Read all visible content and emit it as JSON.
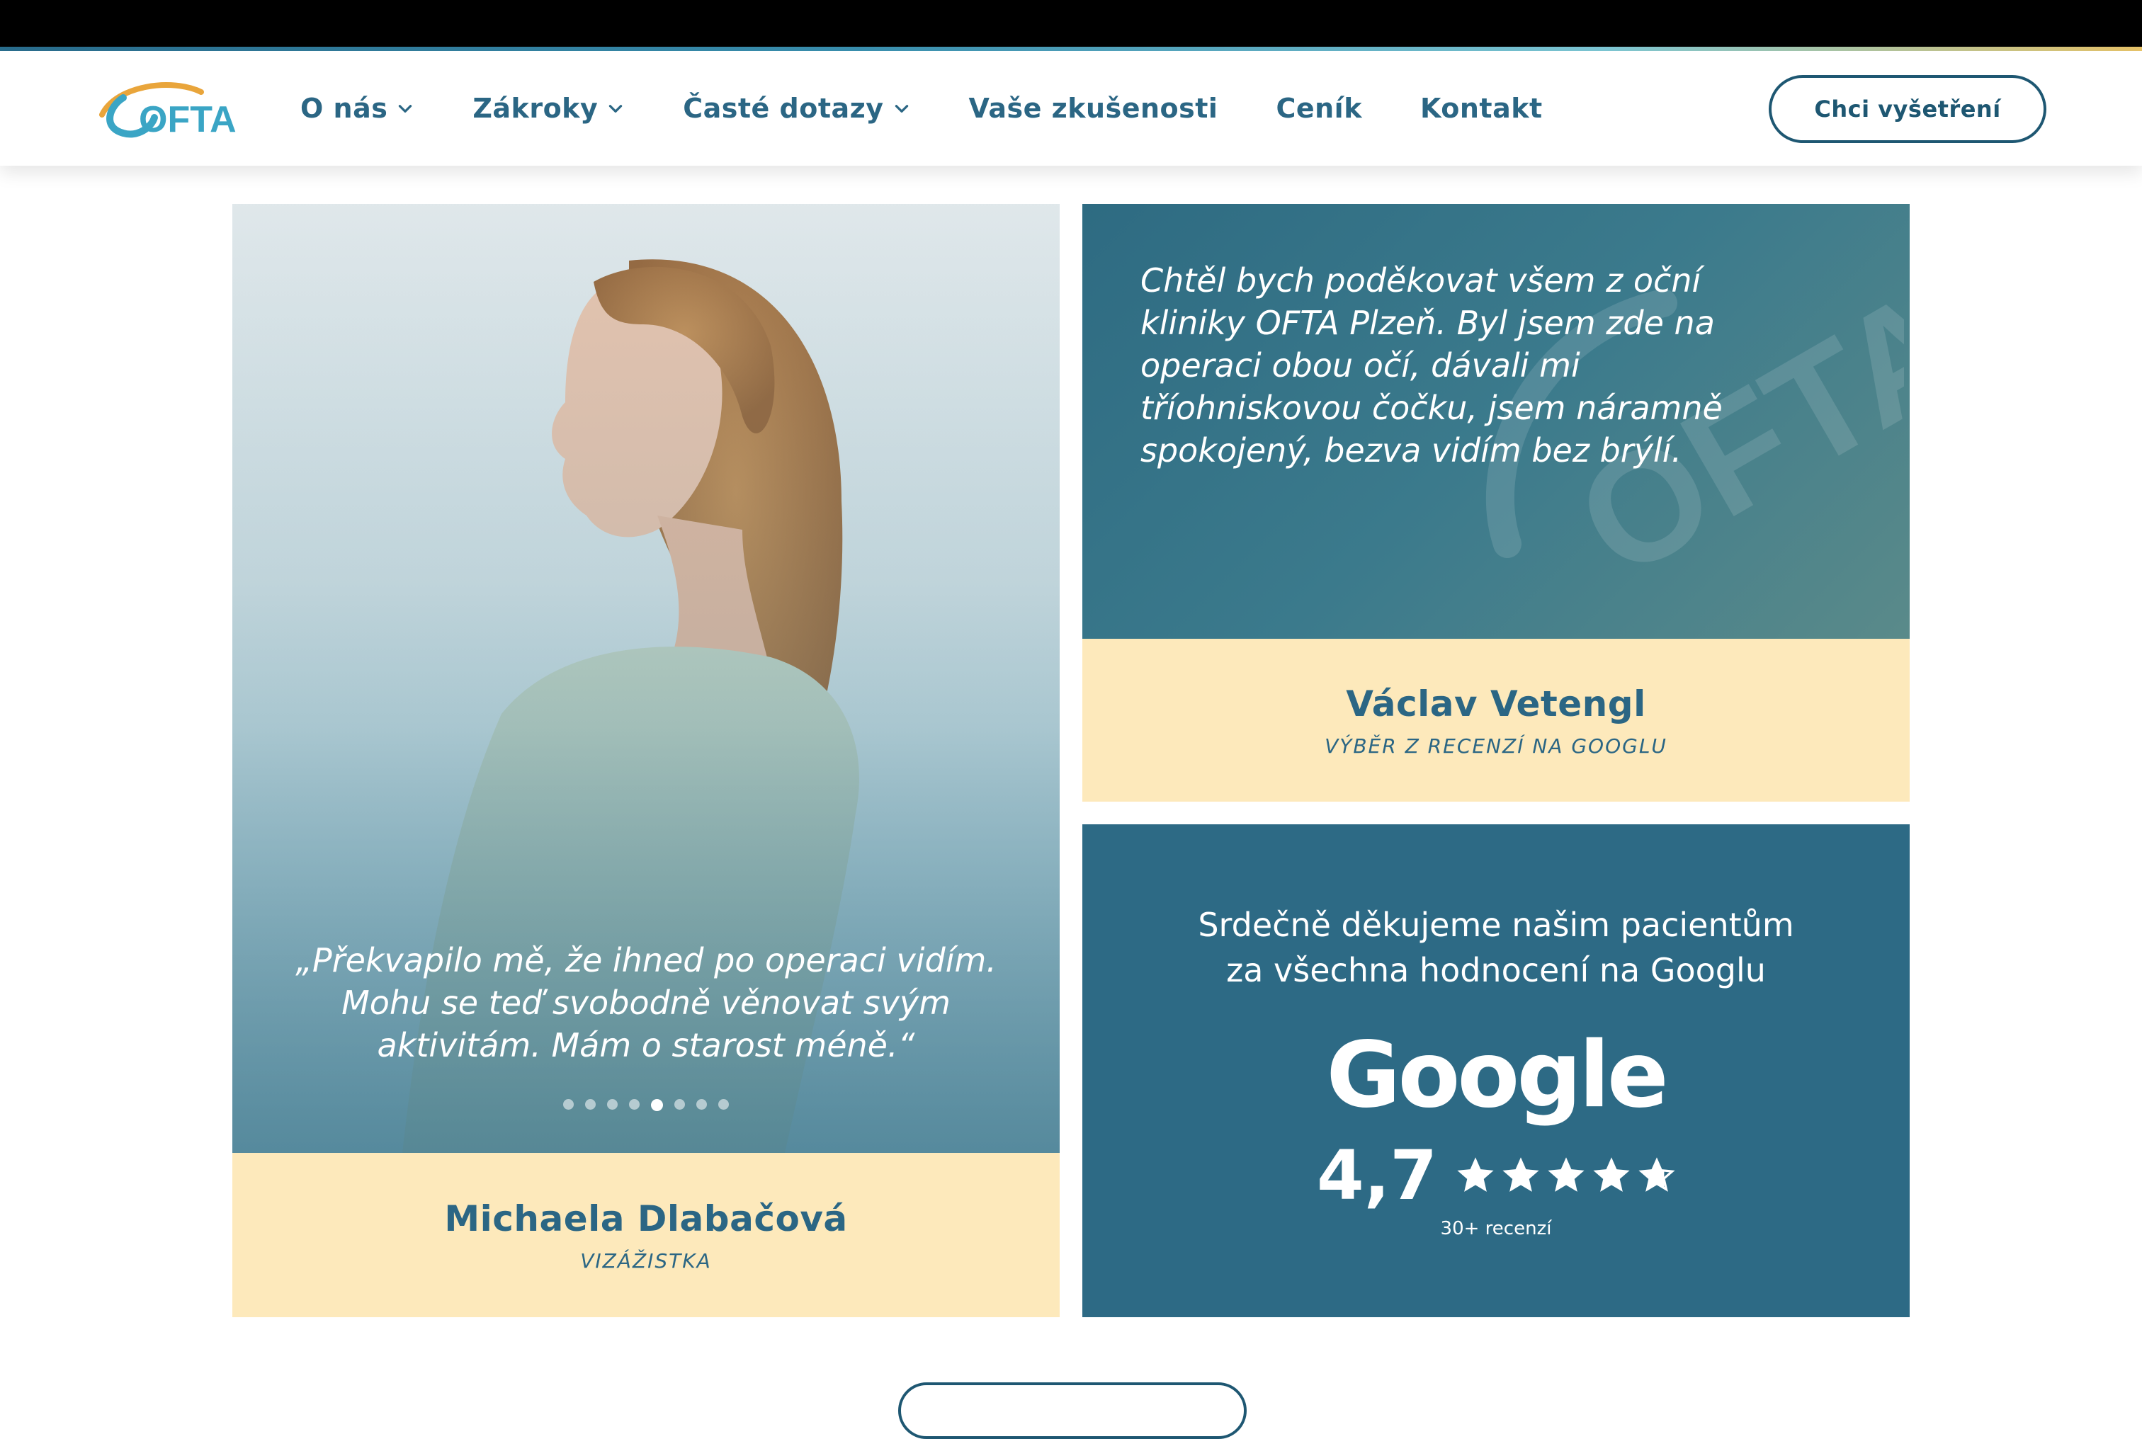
{
  "header": {
    "logo_text": "OFTA",
    "nav": [
      {
        "label": "O nás",
        "dropdown": true
      },
      {
        "label": "Zákroky",
        "dropdown": true
      },
      {
        "label": "Časté dotazy",
        "dropdown": true
      },
      {
        "label": "Vaše zkušenosti",
        "dropdown": false
      },
      {
        "label": "Ceník",
        "dropdown": false
      },
      {
        "label": "Kontakt",
        "dropdown": false
      }
    ],
    "cta_label": "Chci vyšetření"
  },
  "testimonial_left": {
    "quote": "„Překvapilo mě, že ihned po operaci vidím. Mohu se teď svobodně věnovat svým aktivitám. Mám o starost méně.“",
    "name": "Michaela Dlabačová",
    "role": "VIZÁŽISTKA",
    "slides_total": 8,
    "slide_active": 5
  },
  "review_right": {
    "text": "Chtěl bych poděkovat všem z oční kliniky OFTA Plzeň. Byl jsem zde na operaci obou očí, dávali mi tříohniskovou čočku, jsem náramně spokojený, bezva vidím bez brýlí.",
    "name": "Václav Vetengl",
    "source": "VÝBĚR Z RECENZÍ NA GOOGLU"
  },
  "google": {
    "title_line1": "Srdečně děkujeme našim pacientům",
    "title_line2": "za všechna hodnocení na Googlu",
    "brand": "Google",
    "rating": "4,7",
    "rating_value": 4.7,
    "stars_max": 5,
    "count": "30+ recenzí"
  },
  "colors": {
    "brand_blue": "#2b6684",
    "card_teal": "#2d6a85",
    "cream": "#fde9bb"
  },
  "icons": {
    "chevron": "chevron-down-icon",
    "star": "star-icon"
  }
}
